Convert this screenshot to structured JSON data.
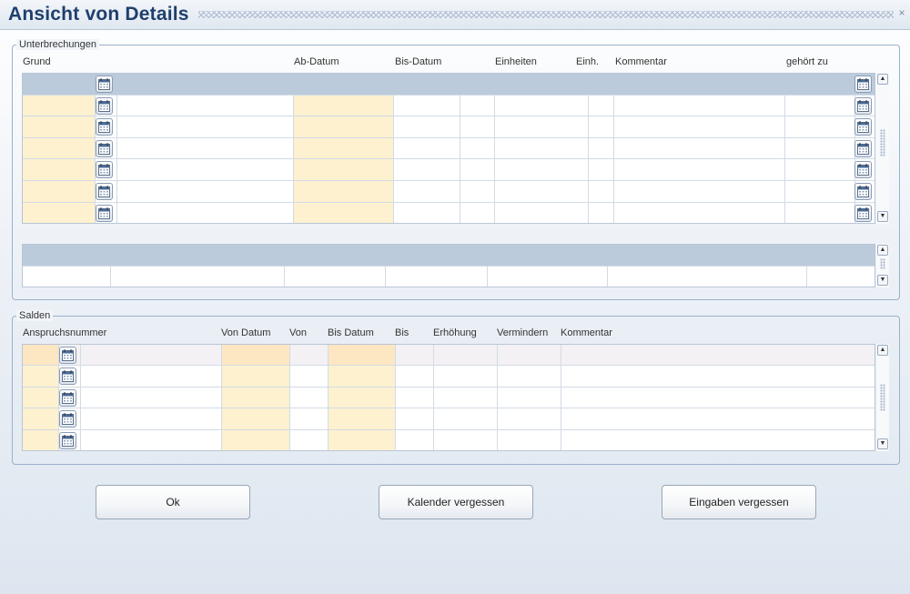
{
  "window": {
    "title": "Ansicht von Details",
    "close_glyph": "×"
  },
  "unterbrechungen": {
    "legend": "Unterbrechungen",
    "columns": {
      "grund": "Grund",
      "ab_datum": "Ab-Datum",
      "bis_datum": "Bis-Datum",
      "einheiten": "Einheiten",
      "einh": "Einh.",
      "kommentar": "Kommentar",
      "gehoert_zu": "gehört zu"
    }
  },
  "salden": {
    "legend": "Salden",
    "columns": {
      "anspruchsnummer": "Anspruchsnummer",
      "von_datum": "Von Datum",
      "von": "Von",
      "bis_datum": "Bis Datum",
      "bis": "Bis",
      "erhoehung": "Erhöhung",
      "vermindern": "Vermindern",
      "kommentar": "Kommentar"
    }
  },
  "buttons": {
    "ok": "Ok",
    "kalender_vergessen": "Kalender vergessen",
    "eingaben_vergessen": "Eingaben vergessen"
  },
  "icons": {
    "calendar": "calendar-icon",
    "scroll_up": "▲",
    "scroll_down": "▼",
    "close": "close-icon"
  },
  "colors": {
    "title_text": "#1f3f6d",
    "required_cell": "#fdf1cf",
    "selected_row": "#bccbdc",
    "group_border": "#9cb1cc"
  }
}
